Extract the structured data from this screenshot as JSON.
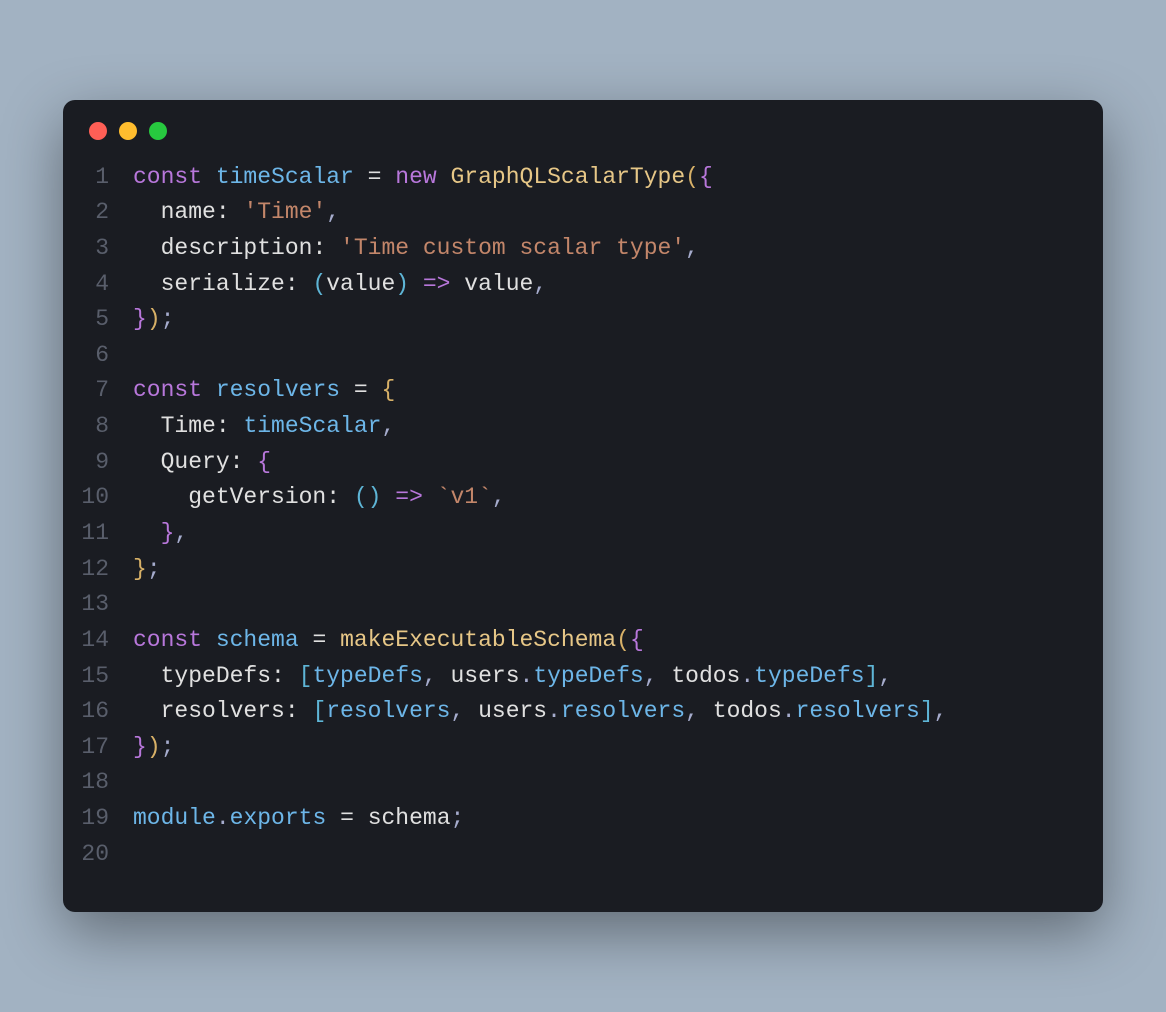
{
  "window": {
    "controls": [
      "close",
      "minimize",
      "maximize"
    ]
  },
  "code": {
    "language": "javascript",
    "lines": [
      {
        "n": 1,
        "tokens": [
          {
            "t": "const ",
            "c": "kw"
          },
          {
            "t": "timeScalar",
            "c": "name"
          },
          {
            "t": " = ",
            "c": "op"
          },
          {
            "t": "new ",
            "c": "new"
          },
          {
            "t": "GraphQLScalarType",
            "c": "type"
          },
          {
            "t": "(",
            "c": "paren"
          },
          {
            "t": "{",
            "c": "brace"
          }
        ]
      },
      {
        "n": 2,
        "tokens": [
          {
            "t": "  name",
            "c": "prop"
          },
          {
            "t": ": ",
            "c": "op"
          },
          {
            "t": "'Time'",
            "c": "str"
          },
          {
            "t": ",",
            "c": "punct"
          }
        ]
      },
      {
        "n": 3,
        "tokens": [
          {
            "t": "  description",
            "c": "prop"
          },
          {
            "t": ": ",
            "c": "op"
          },
          {
            "t": "'Time custom scalar type'",
            "c": "str"
          },
          {
            "t": ",",
            "c": "punct"
          }
        ]
      },
      {
        "n": 4,
        "tokens": [
          {
            "t": "  serialize",
            "c": "prop"
          },
          {
            "t": ": ",
            "c": "op"
          },
          {
            "t": "(",
            "c": "brace2"
          },
          {
            "t": "value",
            "c": "ident"
          },
          {
            "t": ")",
            "c": "brace2"
          },
          {
            "t": " => ",
            "c": "arrow"
          },
          {
            "t": "value",
            "c": "ident"
          },
          {
            "t": ",",
            "c": "punct"
          }
        ]
      },
      {
        "n": 5,
        "tokens": [
          {
            "t": "}",
            "c": "brace"
          },
          {
            "t": ")",
            "c": "paren"
          },
          {
            "t": ";",
            "c": "punct"
          }
        ]
      },
      {
        "n": 6,
        "tokens": []
      },
      {
        "n": 7,
        "tokens": [
          {
            "t": "const ",
            "c": "kw"
          },
          {
            "t": "resolvers",
            "c": "name"
          },
          {
            "t": " = ",
            "c": "op"
          },
          {
            "t": "{",
            "c": "paren"
          }
        ]
      },
      {
        "n": 8,
        "tokens": [
          {
            "t": "  Time",
            "c": "prop"
          },
          {
            "t": ": ",
            "c": "op"
          },
          {
            "t": "timeScalar",
            "c": "name"
          },
          {
            "t": ",",
            "c": "punct"
          }
        ]
      },
      {
        "n": 9,
        "tokens": [
          {
            "t": "  Query",
            "c": "prop"
          },
          {
            "t": ": ",
            "c": "op"
          },
          {
            "t": "{",
            "c": "brace"
          }
        ]
      },
      {
        "n": 10,
        "tokens": [
          {
            "t": "    getVersion",
            "c": "prop"
          },
          {
            "t": ": ",
            "c": "op"
          },
          {
            "t": "(",
            "c": "brace2"
          },
          {
            "t": ")",
            "c": "brace2"
          },
          {
            "t": " => ",
            "c": "arrow"
          },
          {
            "t": "`v1`",
            "c": "str"
          },
          {
            "t": ",",
            "c": "punct"
          }
        ]
      },
      {
        "n": 11,
        "tokens": [
          {
            "t": "  }",
            "c": "brace"
          },
          {
            "t": ",",
            "c": "punct"
          }
        ]
      },
      {
        "n": 12,
        "tokens": [
          {
            "t": "}",
            "c": "paren"
          },
          {
            "t": ";",
            "c": "punct"
          }
        ]
      },
      {
        "n": 13,
        "tokens": []
      },
      {
        "n": 14,
        "tokens": [
          {
            "t": "const ",
            "c": "kw"
          },
          {
            "t": "schema",
            "c": "name"
          },
          {
            "t": " = ",
            "c": "op"
          },
          {
            "t": "makeExecutableSchema",
            "c": "type"
          },
          {
            "t": "(",
            "c": "paren"
          },
          {
            "t": "{",
            "c": "brace"
          }
        ]
      },
      {
        "n": 15,
        "tokens": [
          {
            "t": "  typeDefs",
            "c": "prop"
          },
          {
            "t": ": ",
            "c": "op"
          },
          {
            "t": "[",
            "c": "brace2"
          },
          {
            "t": "typeDefs",
            "c": "name"
          },
          {
            "t": ", ",
            "c": "punct"
          },
          {
            "t": "users",
            "c": "ident"
          },
          {
            "t": ".",
            "c": "punct"
          },
          {
            "t": "typeDefs",
            "c": "member"
          },
          {
            "t": ", ",
            "c": "punct"
          },
          {
            "t": "todos",
            "c": "ident"
          },
          {
            "t": ".",
            "c": "punct"
          },
          {
            "t": "typeDefs",
            "c": "member"
          },
          {
            "t": "]",
            "c": "brace2"
          },
          {
            "t": ",",
            "c": "punct"
          }
        ]
      },
      {
        "n": 16,
        "tokens": [
          {
            "t": "  resolvers",
            "c": "prop"
          },
          {
            "t": ": ",
            "c": "op"
          },
          {
            "t": "[",
            "c": "brace2"
          },
          {
            "t": "resolvers",
            "c": "name"
          },
          {
            "t": ", ",
            "c": "punct"
          },
          {
            "t": "users",
            "c": "ident"
          },
          {
            "t": ".",
            "c": "punct"
          },
          {
            "t": "resolvers",
            "c": "member"
          },
          {
            "t": ", ",
            "c": "punct"
          },
          {
            "t": "todos",
            "c": "ident"
          },
          {
            "t": ".",
            "c": "punct"
          },
          {
            "t": "resolvers",
            "c": "member"
          },
          {
            "t": "]",
            "c": "brace2"
          },
          {
            "t": ",",
            "c": "punct"
          }
        ]
      },
      {
        "n": 17,
        "tokens": [
          {
            "t": "}",
            "c": "brace"
          },
          {
            "t": ")",
            "c": "paren"
          },
          {
            "t": ";",
            "c": "punct"
          }
        ]
      },
      {
        "n": 18,
        "tokens": []
      },
      {
        "n": 19,
        "tokens": [
          {
            "t": "module",
            "c": "name"
          },
          {
            "t": ".",
            "c": "punct"
          },
          {
            "t": "exports",
            "c": "member"
          },
          {
            "t": " = ",
            "c": "op"
          },
          {
            "t": "schema",
            "c": "ident"
          },
          {
            "t": ";",
            "c": "punct"
          }
        ]
      },
      {
        "n": 20,
        "tokens": []
      }
    ]
  }
}
